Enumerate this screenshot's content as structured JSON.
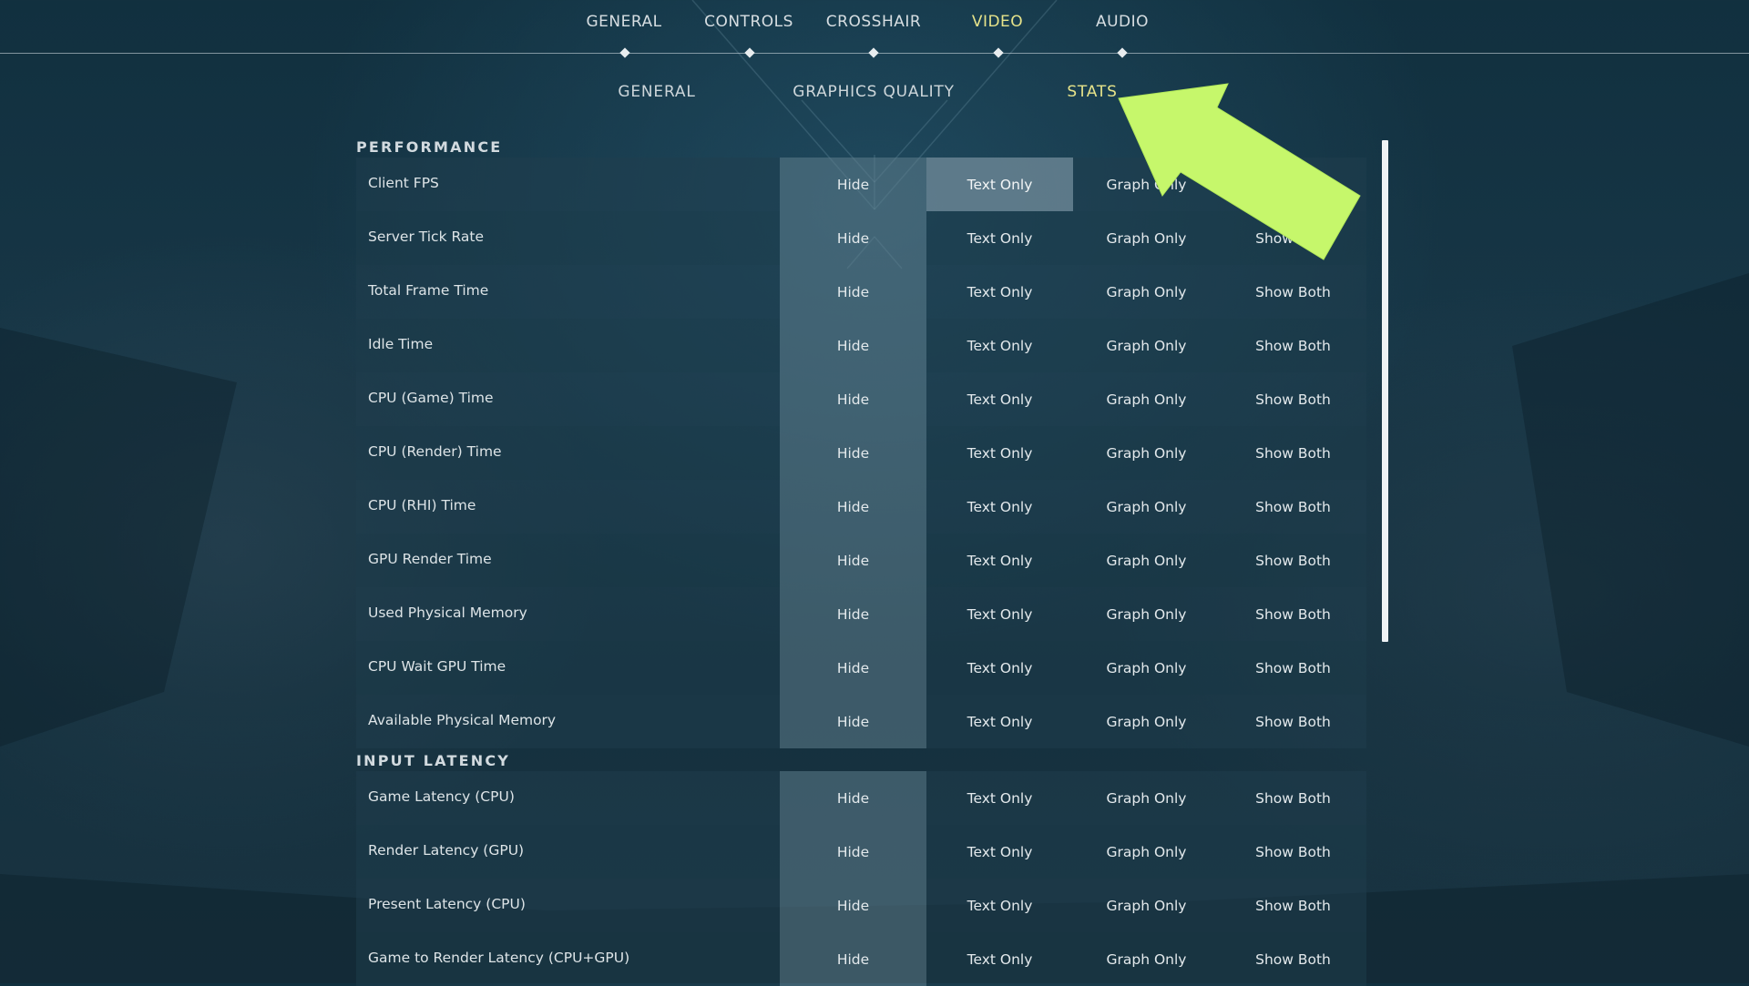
{
  "top_tabs": [
    {
      "label": "GENERAL",
      "active": false
    },
    {
      "label": "CONTROLS",
      "active": false
    },
    {
      "label": "CROSSHAIR",
      "active": false
    },
    {
      "label": "VIDEO",
      "active": true
    },
    {
      "label": "AUDIO",
      "active": false
    }
  ],
  "sub_tabs": [
    {
      "label": "GENERAL",
      "active": false
    },
    {
      "label": "GRAPHICS QUALITY",
      "active": false
    },
    {
      "label": "STATS",
      "active": true
    }
  ],
  "options": [
    "Hide",
    "Text Only",
    "Graph Only",
    "Show Both"
  ],
  "sections": [
    {
      "title": "PERFORMANCE",
      "rows": [
        {
          "label": "Client FPS",
          "selected": "Text Only"
        },
        {
          "label": "Server Tick Rate",
          "selected": "Hide"
        },
        {
          "label": "Total Frame Time",
          "selected": "Hide"
        },
        {
          "label": "Idle Time",
          "selected": "Hide"
        },
        {
          "label": "CPU (Game) Time",
          "selected": "Hide"
        },
        {
          "label": "CPU (Render) Time",
          "selected": "Hide"
        },
        {
          "label": "CPU (RHI) Time",
          "selected": "Hide"
        },
        {
          "label": "GPU Render Time",
          "selected": "Hide"
        },
        {
          "label": "Used Physical Memory",
          "selected": "Hide"
        },
        {
          "label": "CPU Wait GPU Time",
          "selected": "Hide"
        },
        {
          "label": "Available Physical Memory",
          "selected": "Hide"
        }
      ]
    },
    {
      "title": "INPUT LATENCY",
      "rows": [
        {
          "label": "Game Latency (CPU)",
          "selected": "Hide"
        },
        {
          "label": "Render Latency (GPU)",
          "selected": "Hide"
        },
        {
          "label": "Present Latency (CPU)",
          "selected": "Hide"
        },
        {
          "label": "Game to Render Latency (CPU+GPU)",
          "selected": "Hide"
        }
      ]
    }
  ],
  "colors": {
    "active_tab": "#e6e38a",
    "arrow": "#c6f76b"
  }
}
